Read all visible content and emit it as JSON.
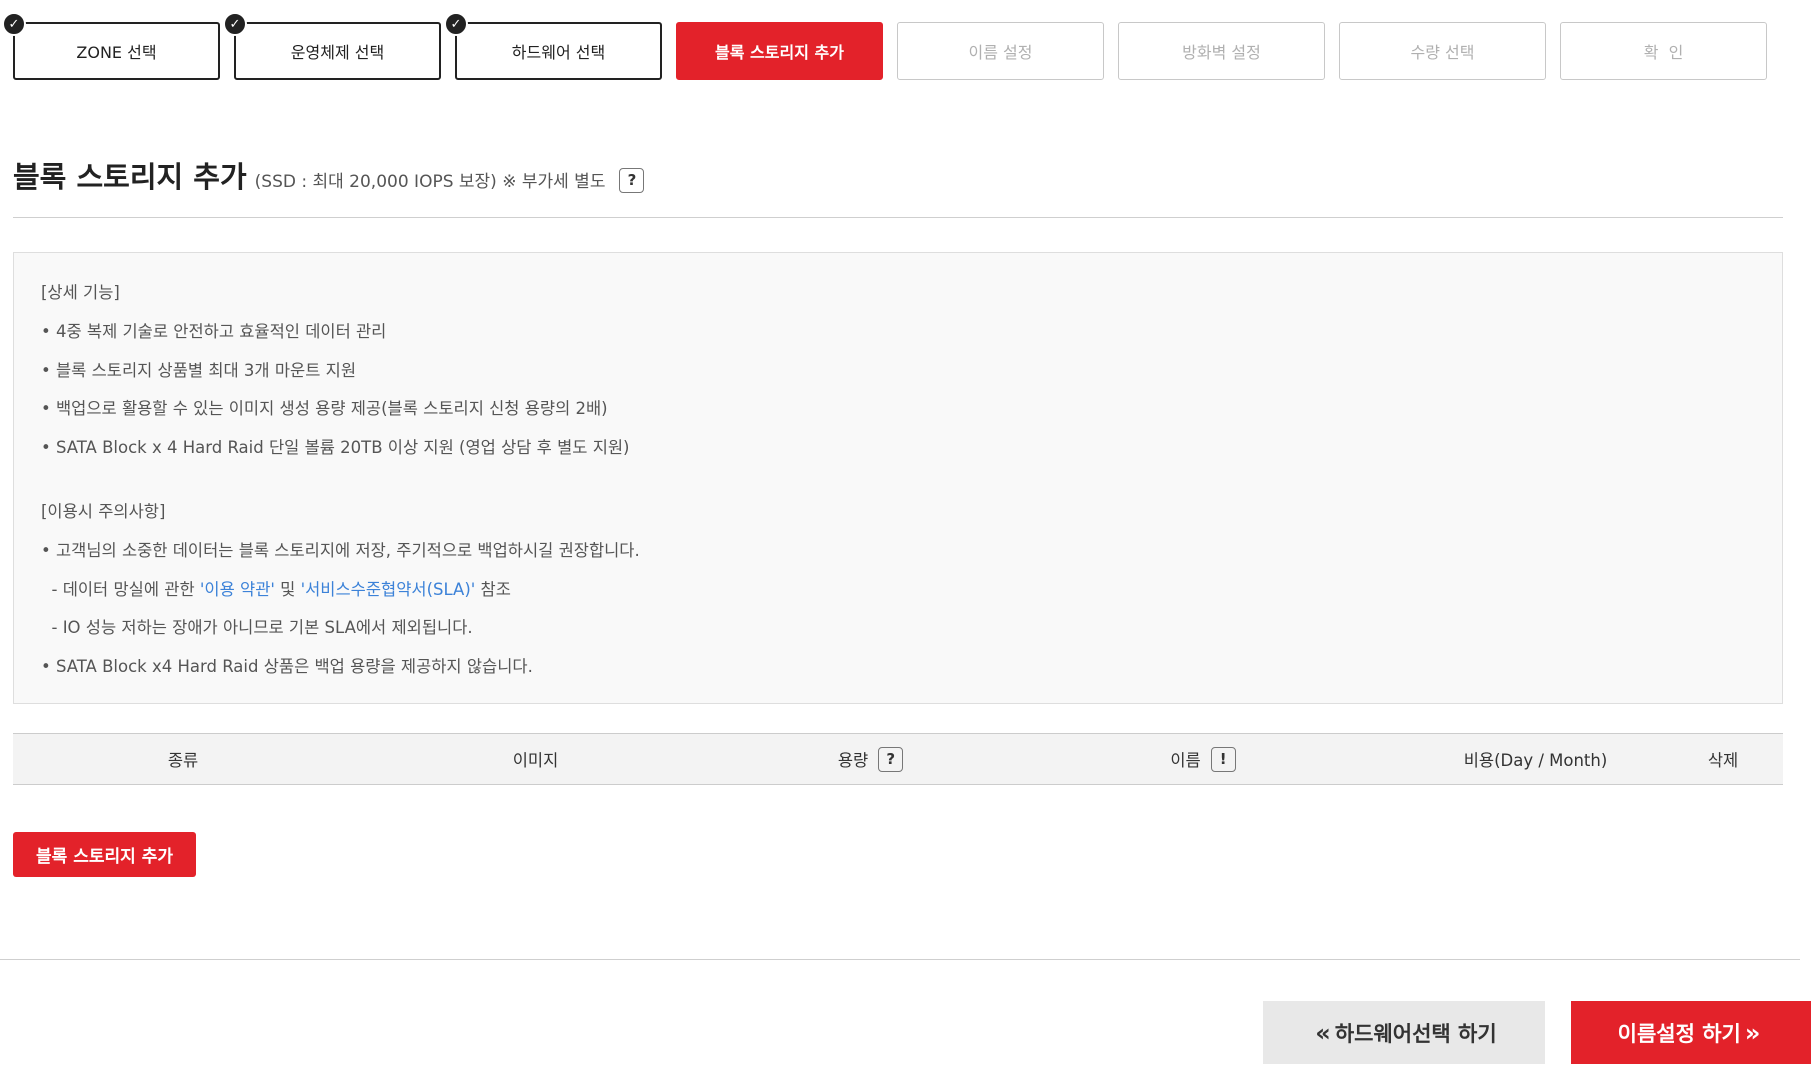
{
  "steps": [
    {
      "label": "ZONE 선택",
      "state": "done"
    },
    {
      "label": "운영체제 선택",
      "state": "done"
    },
    {
      "label": "하드웨어 선택",
      "state": "done"
    },
    {
      "label": "블록 스토리지 추가",
      "state": "active"
    },
    {
      "label": "이름 설정",
      "state": "inactive"
    },
    {
      "label": "방화벽 설정",
      "state": "inactive"
    },
    {
      "label": "수량 선택",
      "state": "inactive"
    },
    {
      "label": "확  인",
      "state": "inactive"
    }
  ],
  "check_glyph": "✓",
  "heading": {
    "title": "블록 스토리지 추가",
    "subtitle": "(SSD : 최대 20,000 IOPS 보장) ※ 부가세 별도",
    "help": "?"
  },
  "info": {
    "features_title": "[상세 기능]",
    "features": [
      "• 4중 복제 기술로 안전하고 효율적인 데이터 관리",
      "• 블록 스토리지 상품별 최대 3개 마운트 지원",
      "• 백업으로 활용할 수 있는 이미지 생성 용량 제공(블록 스토리지 신청 용량의 2배)",
      "• SATA Block x 4 Hard Raid 단일 볼륨 20TB 이상 지원 (영업 상담 후 별도 지원)"
    ],
    "cautions_title": "[이용시 주의사항]",
    "caution_1": "• 고객님의 소중한 데이터는 블록 스토리지에 저장, 주기적으로 백업하시길 권장합니다.",
    "caution_2_prefix": "  - 데이터 망실에 관한 ",
    "caution_2_link1": "'이용 약관'",
    "caution_2_mid": " 및 ",
    "caution_2_link2": "'서비스수준협약서(SLA)'",
    "caution_2_suffix": " 참조",
    "caution_3": "  - IO 성능 저하는 장애가 아니므로 기본 SLA에서 제외됩니다.",
    "caution_4": "• SATA Block x4 Hard Raid 상품은 백업 용량을 제공하지 않습니다."
  },
  "table": {
    "col_type": "종류",
    "col_image": "이미지",
    "col_capacity": "용량",
    "col_capacity_help": "?",
    "col_name": "이름",
    "col_name_alert": "!",
    "col_cost": "비용(Day / Month)",
    "col_delete": "삭제"
  },
  "add_button": "블록 스토리지 추가",
  "nav": {
    "prev_arrow": "«",
    "prev_label": "하드웨어선택 하기",
    "next_label": "이름설정 하기",
    "next_arrow": "»"
  },
  "colors": {
    "accent": "#e3222a",
    "link": "#3c82d8"
  }
}
